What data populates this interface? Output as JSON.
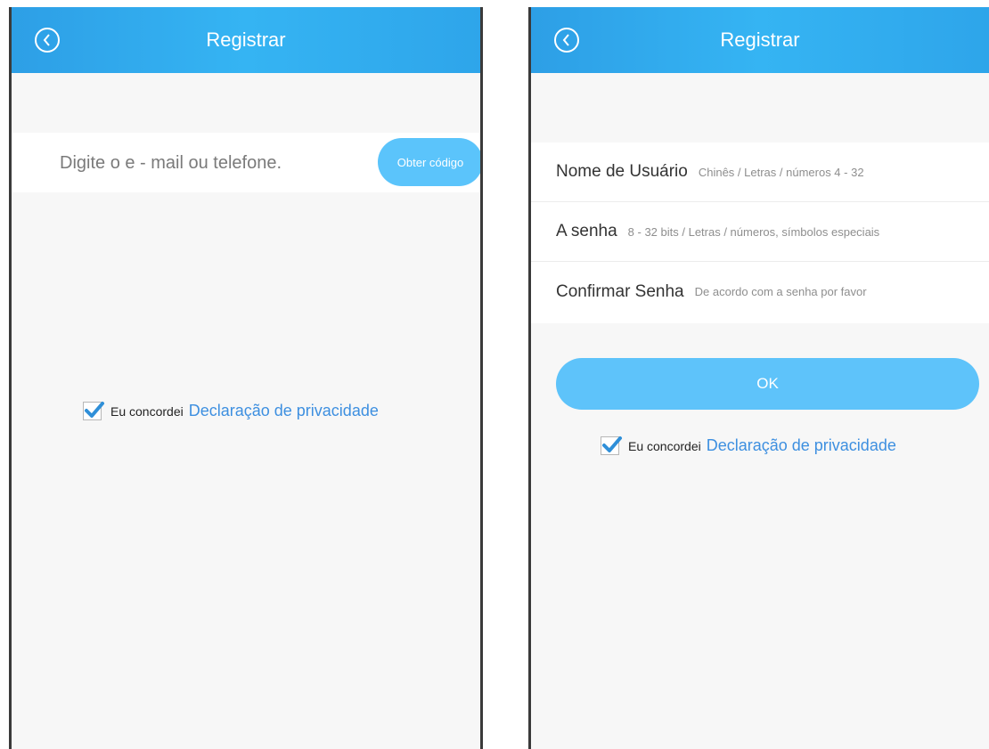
{
  "left": {
    "title": "Registrar",
    "email_placeholder": "Digite o e - mail ou telefone.",
    "code_button": "Obter código",
    "agree_text": "Eu concordei",
    "privacy_link": "Declaração de privacidade",
    "agree_checked": true
  },
  "right": {
    "title": "Registrar",
    "fields": [
      {
        "label": "Nome de Usuário",
        "placeholder": "Chinês / Letras / números 4 - 32"
      },
      {
        "label": "A senha",
        "placeholder": "8 - 32 bits / Letras / números, símbolos especiais"
      },
      {
        "label": "Confirmar Senha",
        "placeholder": "De acordo com a senha por favor"
      }
    ],
    "ok_button": "OK",
    "agree_text": "Eu concordei",
    "privacy_link": "Declaração de privacidade",
    "agree_checked": true
  },
  "colors": {
    "header": "#2ea5ea",
    "button": "#5ec3fa",
    "link": "#3d8fe0",
    "check": "#2f8fd8"
  }
}
